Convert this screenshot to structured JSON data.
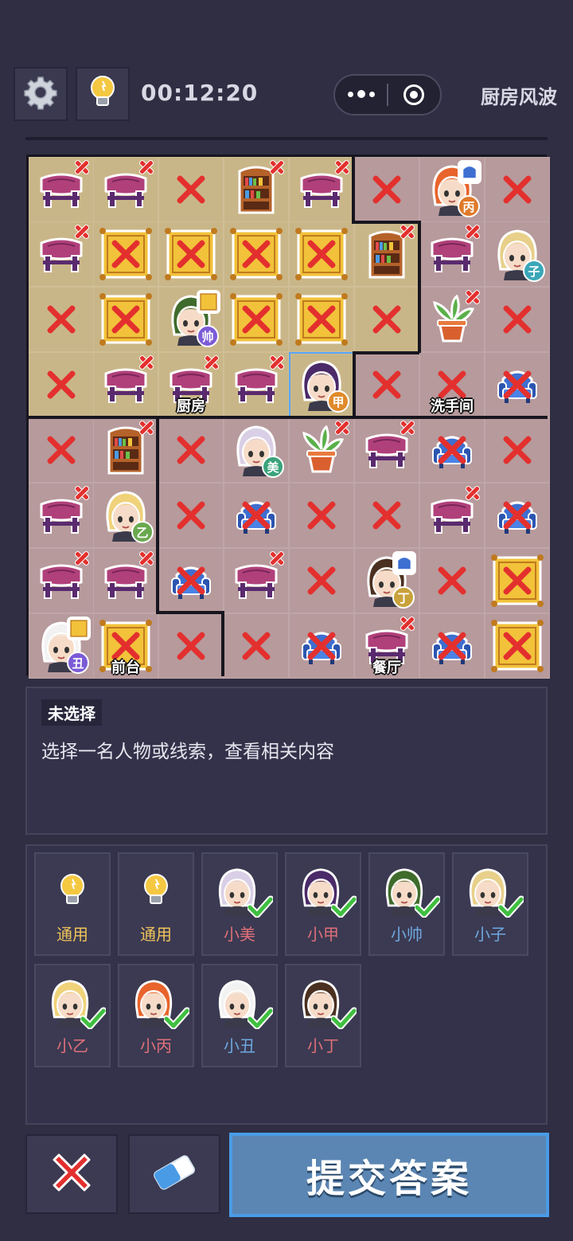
{
  "header": {
    "timer": "00:12:20",
    "level_title": "厨房风波",
    "icons": {
      "settings": "gear-icon",
      "hint": "lightbulb-icon",
      "more": "more-dots-icon",
      "close": "capsule-close-icon"
    }
  },
  "board": {
    "rows": 8,
    "cols": 8,
    "zones": {
      "k": "厨房",
      "r": "other-room"
    },
    "room_labels": [
      {
        "text": "厨房",
        "row": 3,
        "col": 2
      },
      {
        "text": "洗手间",
        "row": 3,
        "col": 6
      },
      {
        "text": "前台",
        "row": 7,
        "col": 1
      },
      {
        "text": "餐厅",
        "row": 7,
        "col": 5
      }
    ],
    "cells": [
      [
        "k:table:x",
        "k:table:x",
        "k:empty:X",
        "k:shelf:x",
        "k:table:x",
        "r:empty:X",
        "r:person:丙",
        "r:empty:X"
      ],
      [
        "k:table:x",
        "k:rug:X",
        "k:rug:X",
        "k:rug:X",
        "k:rug:X",
        "k:shelf:x",
        "r:table:x",
        "r:person:子"
      ],
      [
        "k:empty:X",
        "k:rug:X",
        "k:person:帅",
        "k:rug:X",
        "k:rug:X",
        "k:empty:X",
        "r:plant:x",
        "r:empty:X"
      ],
      [
        "k:empty:X",
        "k:table:x",
        "k:table:x",
        "k:table:x",
        "k:person:甲",
        "r:empty:X",
        "r:empty:X",
        "r:chair:X"
      ],
      [
        "r:empty:X",
        "r:shelf:x",
        "r:empty:X",
        "r:person:美",
        "r:plant:x",
        "r:table:x",
        "r:chair:X",
        "r:empty:X"
      ],
      [
        "r:table:x",
        "r:person:乙",
        "r:empty:X",
        "r:chair:X",
        "r:empty:X",
        "r:empty:X",
        "r:table:x",
        "r:chair:X"
      ],
      [
        "r:table:x",
        "r:table:x",
        "r:chair:X",
        "r:table:x",
        "r:empty:X",
        "r:person:丁",
        "r:empty:X",
        "r:rug:X"
      ],
      [
        "r:person:丑",
        "r:rug:X",
        "r:empty:X",
        "r:empty:X",
        "r:chair:X",
        "r:table:x",
        "r:chair:X",
        "r:rug:X"
      ]
    ],
    "people": {
      "丙": {
        "hair": "#e8642c",
        "tag": "#e07a2a",
        "extra": "chair"
      },
      "子": {
        "hair": "#e8d08a",
        "tag": "#3aa7b8",
        "extra": ""
      },
      "帅": {
        "hair": "#3f6b2c",
        "tag": "#7b5bd6",
        "extra": "rug"
      },
      "甲": {
        "hair": "#4a2a68",
        "tag": "#e08a2a",
        "extra": ""
      },
      "美": {
        "hair": "#d9cfe6",
        "tag": "#3aa37a",
        "extra": ""
      },
      "乙": {
        "hair": "#f0d27a",
        "tag": "#6aa84f",
        "extra": ""
      },
      "丁": {
        "hair": "#4a3020",
        "tag": "#c9a23a",
        "extra": "chair"
      },
      "丑": {
        "hair": "#f2f2f2",
        "tag": "#7b5bd6",
        "extra": "rug"
      }
    },
    "selected_cell": {
      "row": 3,
      "col": 4
    }
  },
  "info": {
    "title": "未选择",
    "description": "选择一名人物或线索，查看相关内容"
  },
  "roster": [
    {
      "label": "通用",
      "type": "hint",
      "color": "#f0c35a"
    },
    {
      "label": "通用",
      "type": "hint",
      "color": "#f0c35a"
    },
    {
      "label": "小美",
      "type": "person",
      "key": "美",
      "color": "#e0707a"
    },
    {
      "label": "小甲",
      "type": "person",
      "key": "甲",
      "color": "#e0707a"
    },
    {
      "label": "小帅",
      "type": "person",
      "key": "帅",
      "color": "#6fa8e0"
    },
    {
      "label": "小子",
      "type": "person",
      "key": "子",
      "color": "#6fa8e0"
    },
    {
      "label": "小乙",
      "type": "person",
      "key": "乙",
      "color": "#e0707a"
    },
    {
      "label": "小丙",
      "type": "person",
      "key": "丙",
      "color": "#e0707a"
    },
    {
      "label": "小丑",
      "type": "person",
      "key": "丑",
      "color": "#6fa8e0"
    },
    {
      "label": "小丁",
      "type": "person",
      "key": "丁",
      "color": "#e0707a"
    }
  ],
  "actions": {
    "submit_label": "提交答案",
    "clear_icon": "red-x-icon",
    "erase_icon": "eraser-icon"
  }
}
